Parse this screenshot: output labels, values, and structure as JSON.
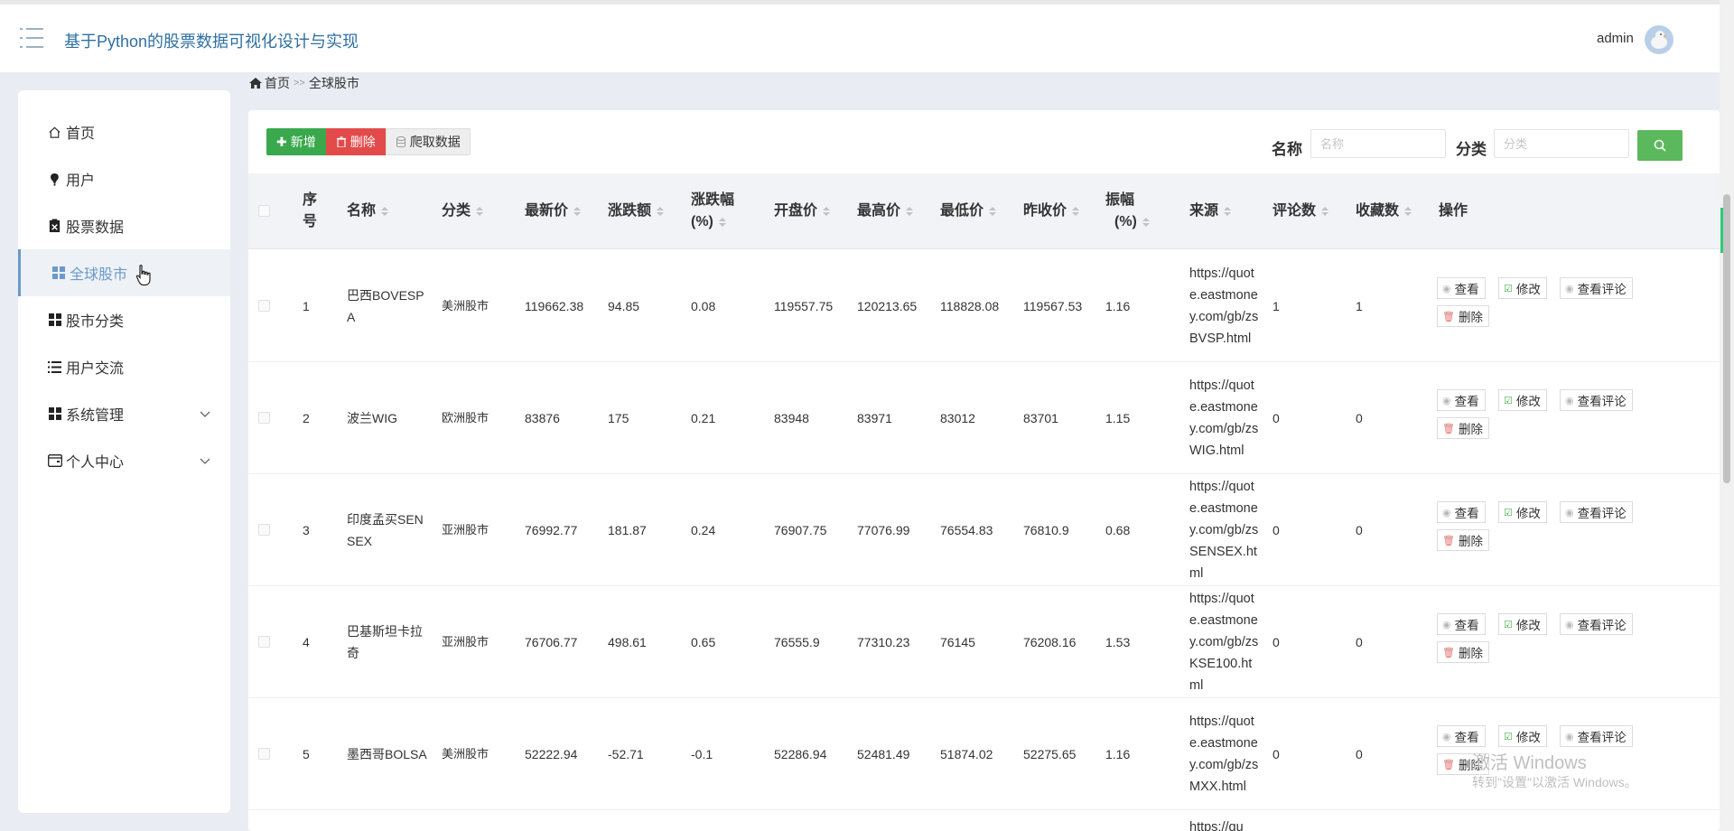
{
  "header": {
    "title": "基于Python的股票数据可视化设计与实现",
    "user": "admin"
  },
  "breadcrumb": {
    "home": "首页",
    "sep": ">>",
    "current": "全球股市"
  },
  "sidebar": {
    "items": [
      {
        "label": "首页",
        "icon": "home-icon"
      },
      {
        "label": "用户",
        "icon": "user-icon"
      },
      {
        "label": "股票数据",
        "icon": "clipboard-icon"
      },
      {
        "label": "全球股市",
        "icon": "grid-icon",
        "active": true
      },
      {
        "label": "股市分类",
        "icon": "grid-icon"
      },
      {
        "label": "用户交流",
        "icon": "list-icon"
      },
      {
        "label": "系统管理",
        "icon": "grid-icon",
        "expandable": true
      },
      {
        "label": "个人中心",
        "icon": "wallet-icon",
        "expandable": true
      }
    ]
  },
  "toolbar": {
    "add": "新增",
    "delete": "删除",
    "crawl": "爬取数据"
  },
  "search": {
    "name_label": "名称",
    "name_placeholder": "名称",
    "category_label": "分类",
    "category_placeholder": "分类"
  },
  "table": {
    "columns": {
      "index": "序号",
      "name": "名称",
      "category": "分类",
      "latest": "最新价",
      "change": "涨跌额",
      "change_pct_1": "涨跌幅",
      "change_pct_2": "(%)",
      "open": "开盘价",
      "high": "最高价",
      "low": "最低价",
      "prev_close": "昨收价",
      "amplitude_1": "振幅",
      "amplitude_2": "(%)",
      "source": "来源",
      "comments": "评论数",
      "favorites": "收藏数",
      "actions": "操作"
    },
    "row_actions": {
      "view": "查看",
      "edit": "修改",
      "view_comments": "查看评论",
      "delete": "删除"
    },
    "rows": [
      {
        "index": "1",
        "name": "巴西BOVESPA",
        "category": "美洲股市",
        "latest": "119662.38",
        "change": "94.85",
        "change_pct": "0.08",
        "open": "119557.75",
        "high": "120213.65",
        "low": "118828.08",
        "prev_close": "119567.53",
        "amplitude": "1.16",
        "source": "https://quote.eastmoney.com/gb/zsBVSP.html",
        "comments": "1",
        "favorites": "1"
      },
      {
        "index": "2",
        "name": "波兰WIG",
        "category": "欧洲股市",
        "latest": "83876",
        "change": "175",
        "change_pct": "0.21",
        "open": "83948",
        "high": "83971",
        "low": "83012",
        "prev_close": "83701",
        "amplitude": "1.15",
        "source": "https://quote.eastmoney.com/gb/zsWIG.html",
        "comments": "0",
        "favorites": "0"
      },
      {
        "index": "3",
        "name": "印度孟买SENSEX",
        "category": "亚洲股市",
        "latest": "76992.77",
        "change": "181.87",
        "change_pct": "0.24",
        "open": "76907.75",
        "high": "77076.99",
        "low": "76554.83",
        "prev_close": "76810.9",
        "amplitude": "0.68",
        "source": "https://quote.eastmoney.com/gb/zsSENSEX.html",
        "comments": "0",
        "favorites": "0"
      },
      {
        "index": "4",
        "name": "巴基斯坦卡拉奇",
        "category": "亚洲股市",
        "latest": "76706.77",
        "change": "498.61",
        "change_pct": "0.65",
        "open": "76555.9",
        "high": "77310.23",
        "low": "76145",
        "prev_close": "76208.16",
        "amplitude": "1.53",
        "source": "https://quote.eastmoney.com/gb/zsKSE100.html",
        "comments": "0",
        "favorites": "0"
      },
      {
        "index": "5",
        "name": "墨西哥BOLSA",
        "category": "美洲股市",
        "latest": "52222.94",
        "change": "-52.71",
        "change_pct": "-0.1",
        "open": "52286.94",
        "high": "52481.49",
        "low": "51874.02",
        "prev_close": "52275.65",
        "amplitude": "1.16",
        "source": "https://quote.eastmoney.com/gb/zsMXX.html",
        "comments": "0",
        "favorites": "0"
      }
    ],
    "partial_next_source": "https://qu"
  },
  "watermark": {
    "line1": "激活 Windows",
    "line2": "转到\"设置\"以激活 Windows。"
  }
}
